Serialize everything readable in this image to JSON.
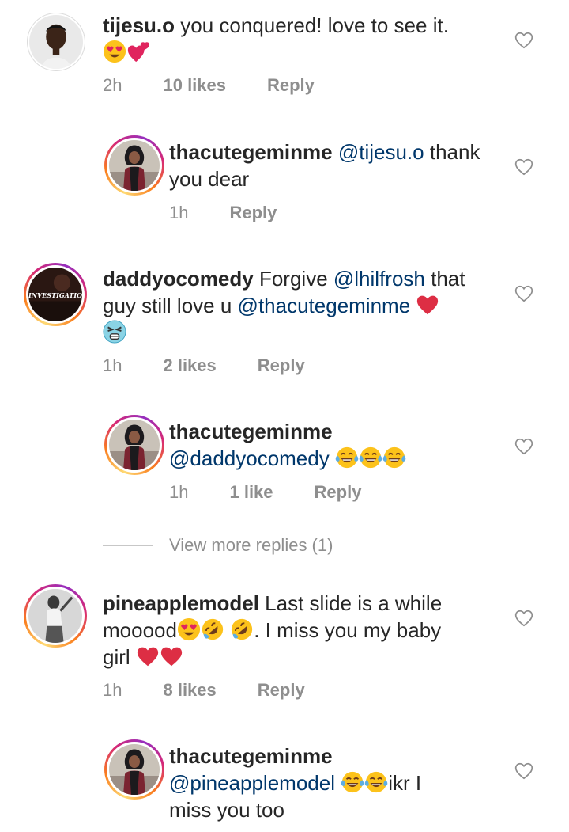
{
  "comments": [
    {
      "username": "tijesu.o",
      "text": "you conquered! love to see it.",
      "time": "2h",
      "likes": "10 likes",
      "reply": "Reply",
      "emojis": [
        "heart-eyes",
        "two-hearts"
      ]
    },
    {
      "username": "thacutegeminme",
      "mention": "@tijesu.o",
      "text": "thank you dear",
      "time": "1h",
      "reply": "Reply"
    },
    {
      "username": "daddyocomedy",
      "text_a": "Forgive",
      "mention_a": "@lhilfrosh",
      "text_b": "that guy still love u",
      "mention_b": "@thacutegeminme",
      "avatar_text": "INVESTIGATION",
      "time": "1h",
      "likes": "2 likes",
      "reply": "Reply",
      "emojis": [
        "red-heart",
        "tired-face"
      ]
    },
    {
      "username": "thacutegeminme",
      "mention": "@daddyocomedy",
      "time": "1h",
      "likes": "1 like",
      "reply": "Reply",
      "emojis": [
        "tears-of-joy",
        "tears-of-joy",
        "tears-of-joy"
      ]
    },
    {
      "username": "pineapplemodel",
      "text_a": "Last slide is a while",
      "text_b": "mooood",
      "text_c": ". I miss you my baby",
      "text_d": "girl",
      "time": "1h",
      "likes": "8 likes",
      "reply": "Reply",
      "emojis": [
        "heart-eyes",
        "rofl",
        "rofl",
        "red-heart",
        "red-heart"
      ]
    },
    {
      "username": "thacutegeminme",
      "mention": "@pineapplemodel",
      "text_a": "ikr I",
      "text_b": "miss you too",
      "emojis": [
        "tears-of-joy",
        "tears-of-joy"
      ]
    }
  ],
  "view_more": "View more replies (1)",
  "colors": {
    "text": "#262626",
    "meta": "#8e8e8e",
    "mention": "#00376b",
    "heart_red": "#e0245e"
  },
  "icons": {
    "like": "heart-outline-icon"
  }
}
